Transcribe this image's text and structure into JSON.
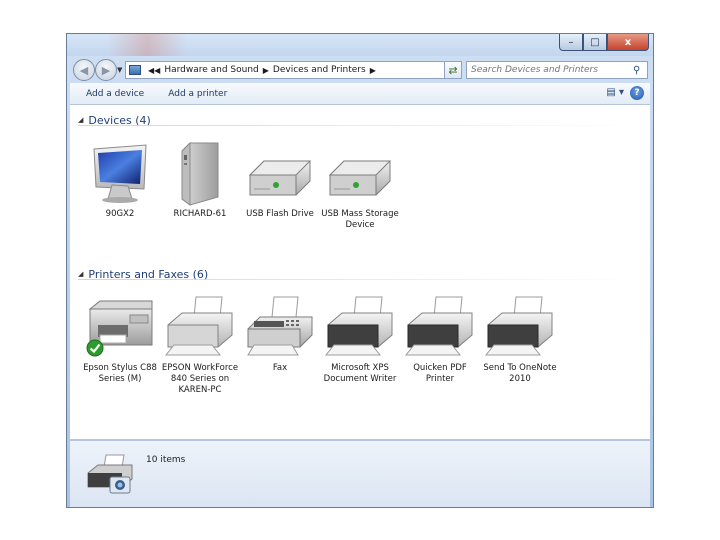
{
  "window": {
    "controls": {
      "minimize": "–",
      "maximize": "□",
      "close": "x"
    }
  },
  "address": {
    "crumbs": [
      "Hardware and Sound",
      "Devices and Printers"
    ],
    "search_placeholder": "Search Devices and Printers"
  },
  "commands": {
    "add_device": "Add a device",
    "add_printer": "Add a printer"
  },
  "groups": {
    "devices": {
      "title": "Devices (4)",
      "items": [
        {
          "label": "90GX2",
          "icon": "monitor-icon"
        },
        {
          "label": "RICHARD-61",
          "icon": "computer-tower-icon"
        },
        {
          "label": "USB Flash Drive",
          "icon": "usb-drive-icon"
        },
        {
          "label": "USB Mass Storage Device",
          "icon": "usb-drive-icon"
        }
      ]
    },
    "printers": {
      "title": "Printers and Faxes (6)",
      "items": [
        {
          "label": "Epson Stylus C88 Series (M)",
          "icon": "multifunction-printer-icon",
          "default": true
        },
        {
          "label": "EPSON WorkForce 840 Series on KAREN-PC",
          "icon": "printer-icon"
        },
        {
          "label": "Fax",
          "icon": "fax-icon"
        },
        {
          "label": "Microsoft XPS Document Writer",
          "icon": "printer-icon"
        },
        {
          "label": "Quicken PDF Printer",
          "icon": "printer-icon"
        },
        {
          "label": "Send To OneNote 2010",
          "icon": "printer-icon"
        }
      ]
    }
  },
  "status": {
    "count": "10 items",
    "icon": "devices-and-printers-icon"
  },
  "colors": {
    "accent": "#1f3f78",
    "default_check": "#2e9b2e"
  }
}
